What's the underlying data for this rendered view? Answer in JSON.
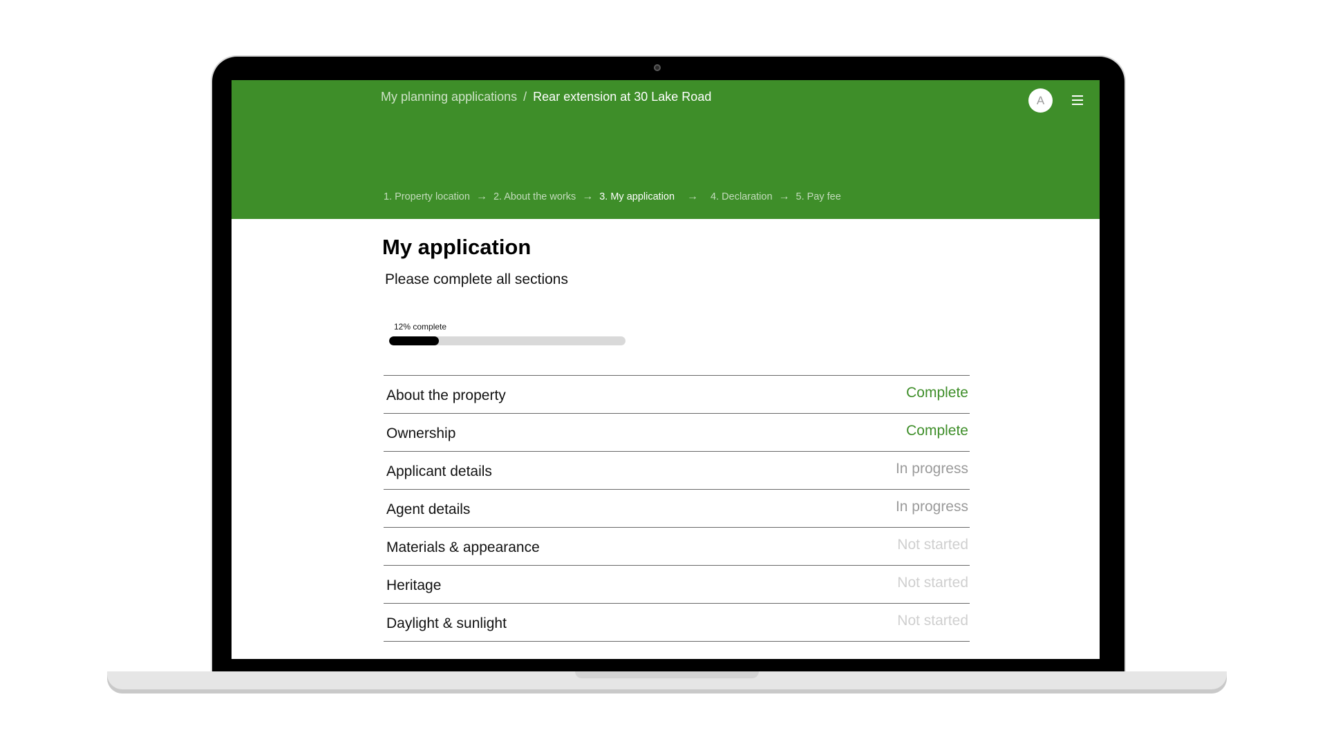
{
  "breadcrumb": {
    "parent": "My planning applications",
    "separator": "/",
    "current": "Rear extension at 30 Lake Road"
  },
  "user": {
    "avatar_initial": "A",
    "menu_icon": "hamburger-menu-icon"
  },
  "steps": [
    {
      "label": "1. Property location",
      "current": false
    },
    {
      "label": "2. About the works",
      "current": false
    },
    {
      "label": "3. My application",
      "current": true
    },
    {
      "label": "4. Declaration",
      "current": false
    },
    {
      "label": "5. Pay fee",
      "current": false
    }
  ],
  "step_arrow": "→",
  "main": {
    "title": "My application",
    "subtitle": "Please complete all sections",
    "progress": {
      "label": "12% complete",
      "percent": 21
    }
  },
  "sections": [
    {
      "name": "About the property",
      "status": "Complete",
      "status_color": "#3e8e29"
    },
    {
      "name": "Ownership",
      "status": "Complete",
      "status_color": "#3e8e29"
    },
    {
      "name": "Applicant details",
      "status": "In progress",
      "status_color": "#9a9a9a"
    },
    {
      "name": "Agent details",
      "status": "In progress",
      "status_color": "#9a9a9a"
    },
    {
      "name": "Materials & appearance",
      "status": "Not started",
      "status_color": "#cfcfcf"
    },
    {
      "name": "Heritage",
      "status": "Not started",
      "status_color": "#cfcfcf"
    },
    {
      "name": "Daylight & sunlight",
      "status": "Not started",
      "status_color": "#cfcfcf"
    }
  ],
  "colors": {
    "header_green": "#3e8e29"
  }
}
